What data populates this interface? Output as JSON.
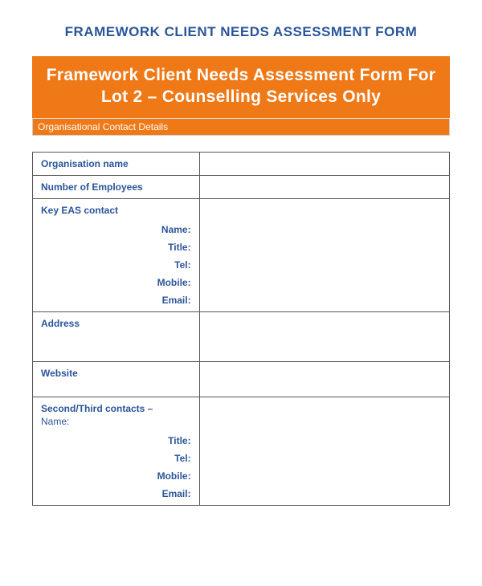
{
  "page_title": "FRAMEWORK CLIENT NEEDS ASSESSMENT FORM",
  "banner": "Framework Client Needs Assessment Form For Lot 2 – Counselling Services Only",
  "section_header": "Organisational Contact Details",
  "fields": {
    "org_name": "Organisation name",
    "num_employees": "Number of Employees",
    "key_eas": "Key EAS contact",
    "name": "Name:",
    "title": "Title:",
    "tel": "Tel:",
    "mobile": "Mobile:",
    "email": "Email:",
    "address": "Address",
    "website": "Website",
    "second_third": "Second/Third contacts –",
    "second_name": "Name:"
  },
  "values": {
    "org_name": "",
    "num_employees": "",
    "key_eas": "",
    "address": "",
    "website": "",
    "second_third": ""
  }
}
